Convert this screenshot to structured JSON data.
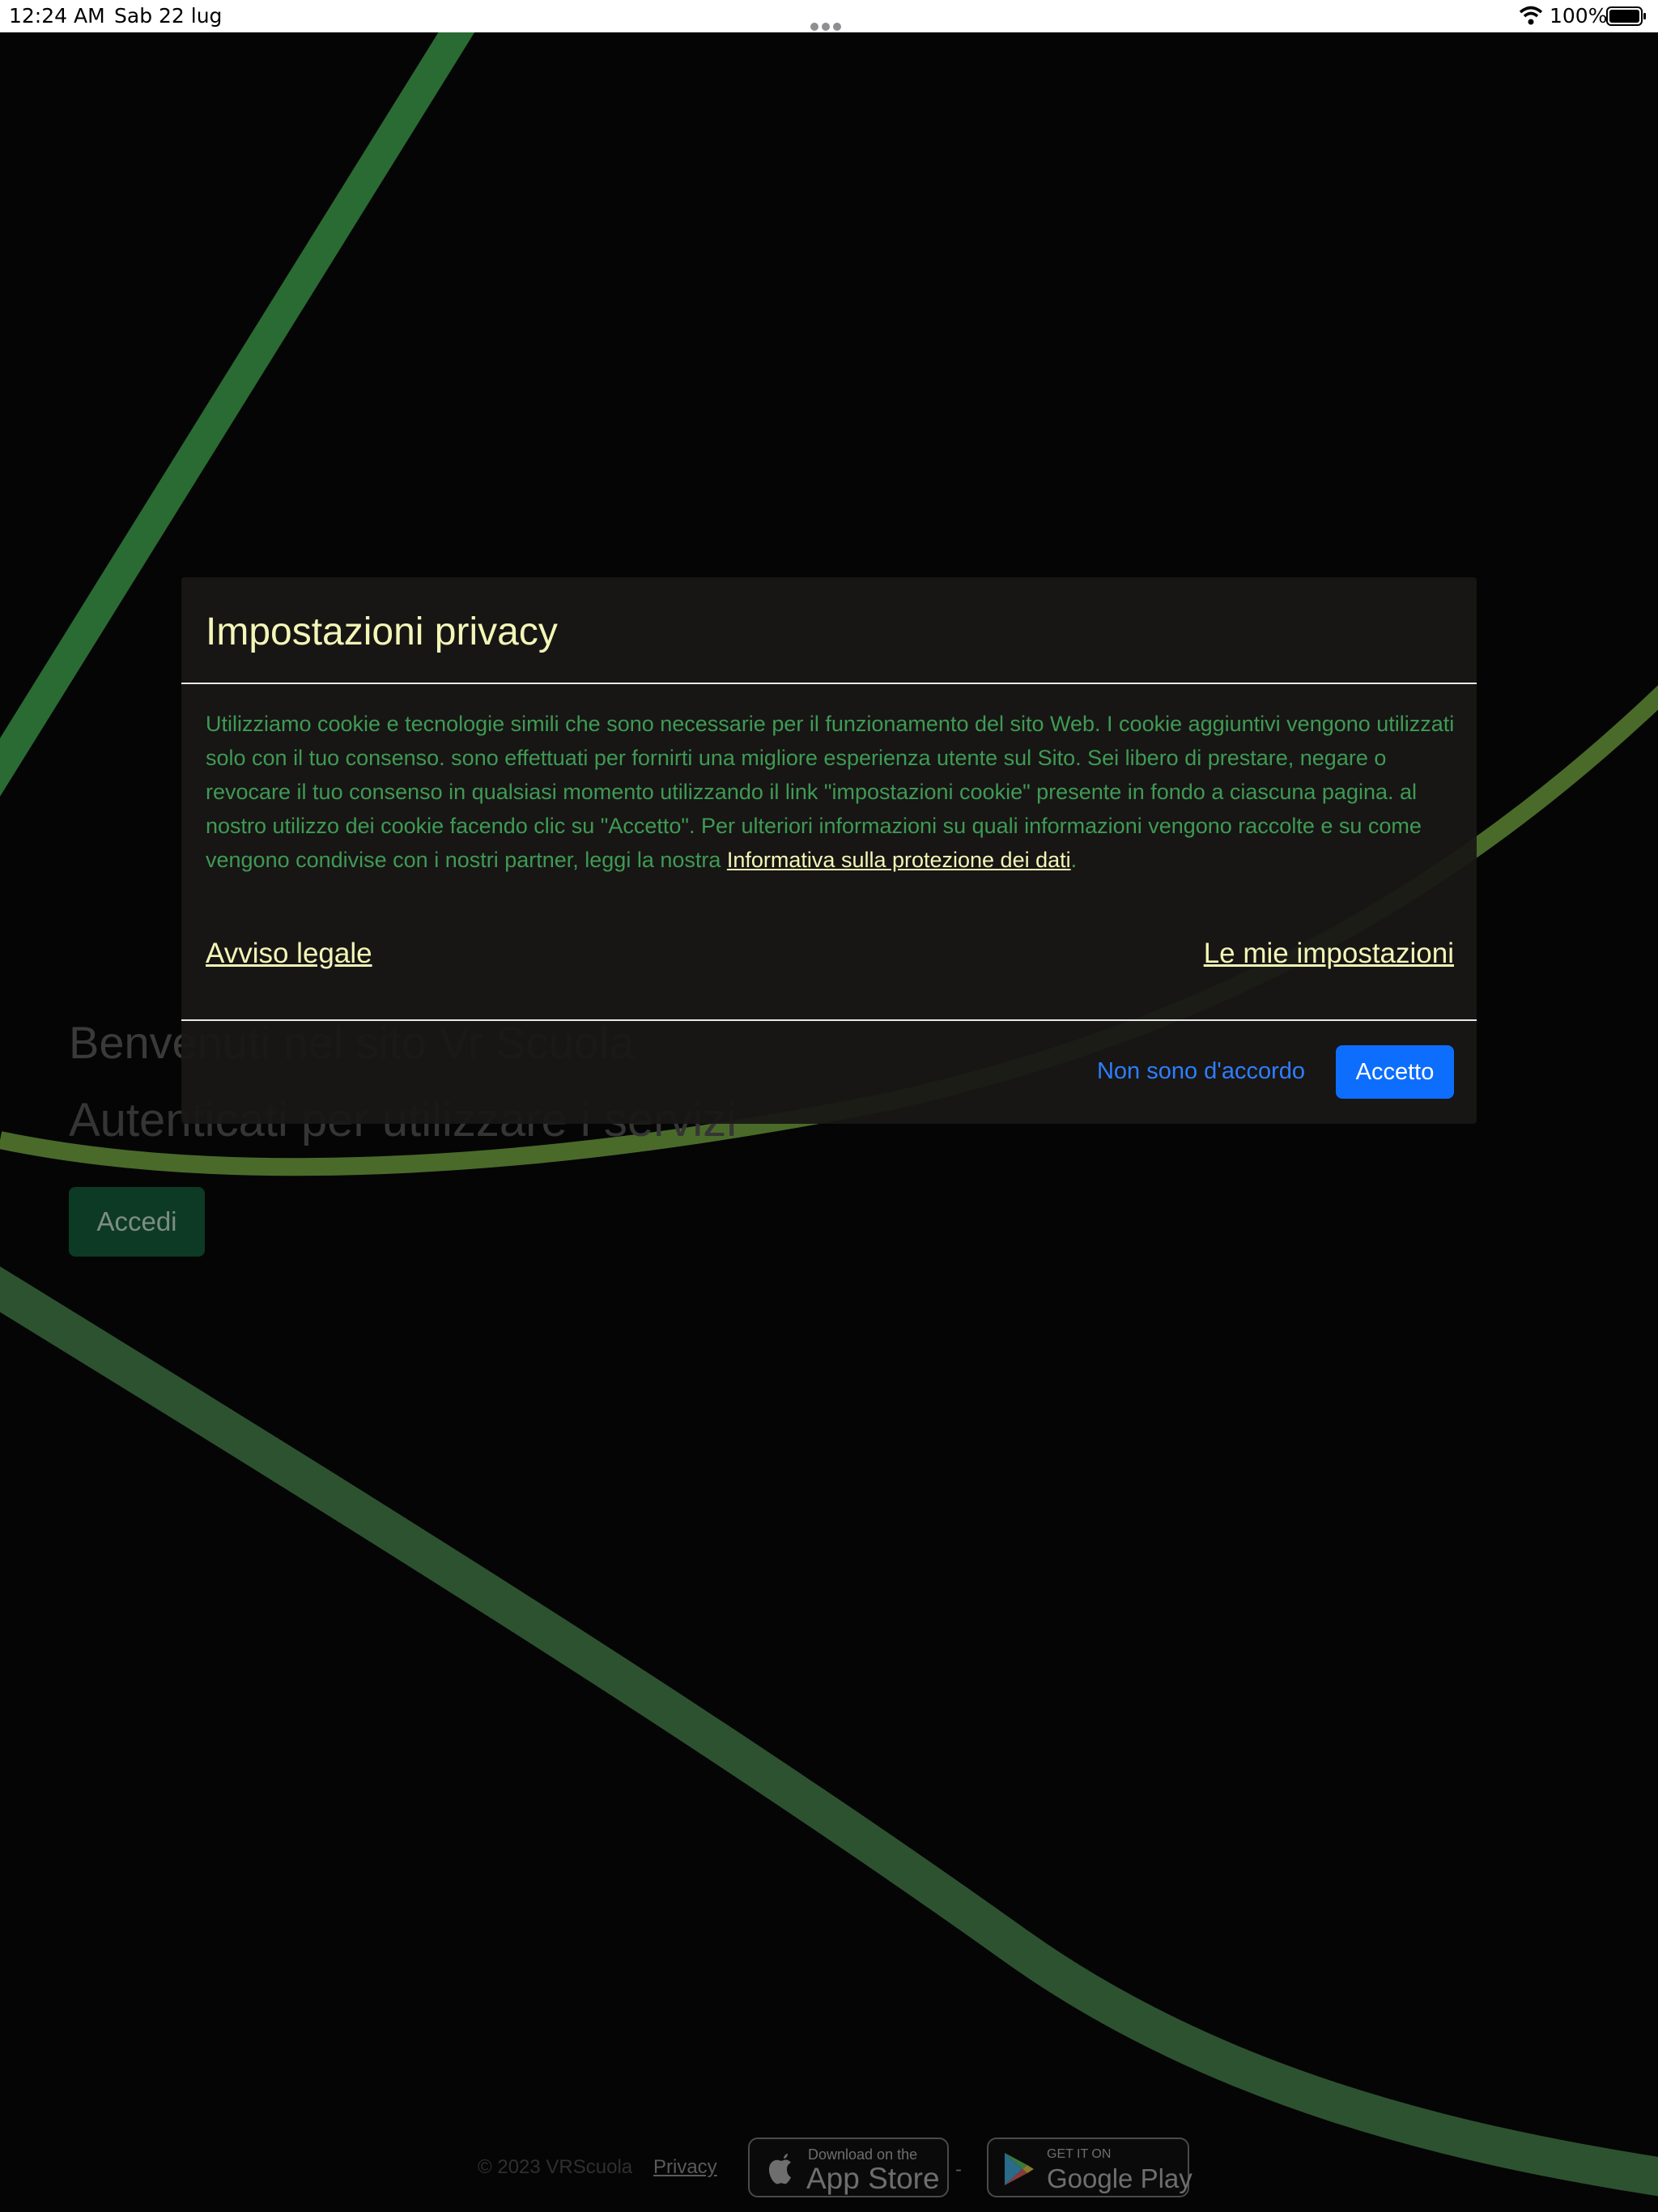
{
  "status_bar": {
    "time": "12:24 AM",
    "date": "Sab 22 lug",
    "battery": "100%"
  },
  "page": {
    "welcome_title": "Benvenuti nel sito Vr Scuola",
    "subtitle": "Autenticati per utilizzare i servizi",
    "login_button": "Accedi"
  },
  "footer": {
    "copyright": "© 2023 VRScuola",
    "privacy_link": "Privacy",
    "separator": "-",
    "app_store": {
      "small": "Download on the",
      "big": "App Store"
    },
    "google_play": {
      "small": "GET IT ON",
      "big": "Google Play"
    }
  },
  "modal": {
    "title": "Impostazioni privacy",
    "body": "Utilizziamo cookie e tecnologie simili che sono necessarie per il funzionamento del sito Web. I cookie aggiuntivi vengono utilizzati solo con il tuo consenso. sono effettuati per fornirti una migliore esperienza utente sul Sito. Sei libero di prestare, negare o revocare il tuo consenso in qualsiasi momento utilizzando il link \"impostazioni cookie\" presente in fondo a ciascuna pagina. al nostro utilizzo dei cookie facendo clic su \"Accetto\". Per ulteriori informazioni su quali informazioni vengono raccolte e su come vengono condivise con i nostri partner, leggi la nostra ",
    "policy_link": "Informativa sulla protezione dei dati",
    "body_end": ".",
    "legal_link": "Avviso legale",
    "settings_link": "Le mie impostazioni",
    "decline_button": "Non sono d'accordo",
    "accept_button": "Accetto"
  },
  "colors": {
    "accent_yellow": "#f3f6b7",
    "body_green": "#3f9a54",
    "accept_blue": "#0d6efd",
    "decline_blue": "#2f7dff",
    "curve_green": "#2e6b35"
  },
  "icons": [
    "wifi-icon",
    "battery-icon",
    "more-dots-icon",
    "apple-icon",
    "google-play-icon"
  ]
}
